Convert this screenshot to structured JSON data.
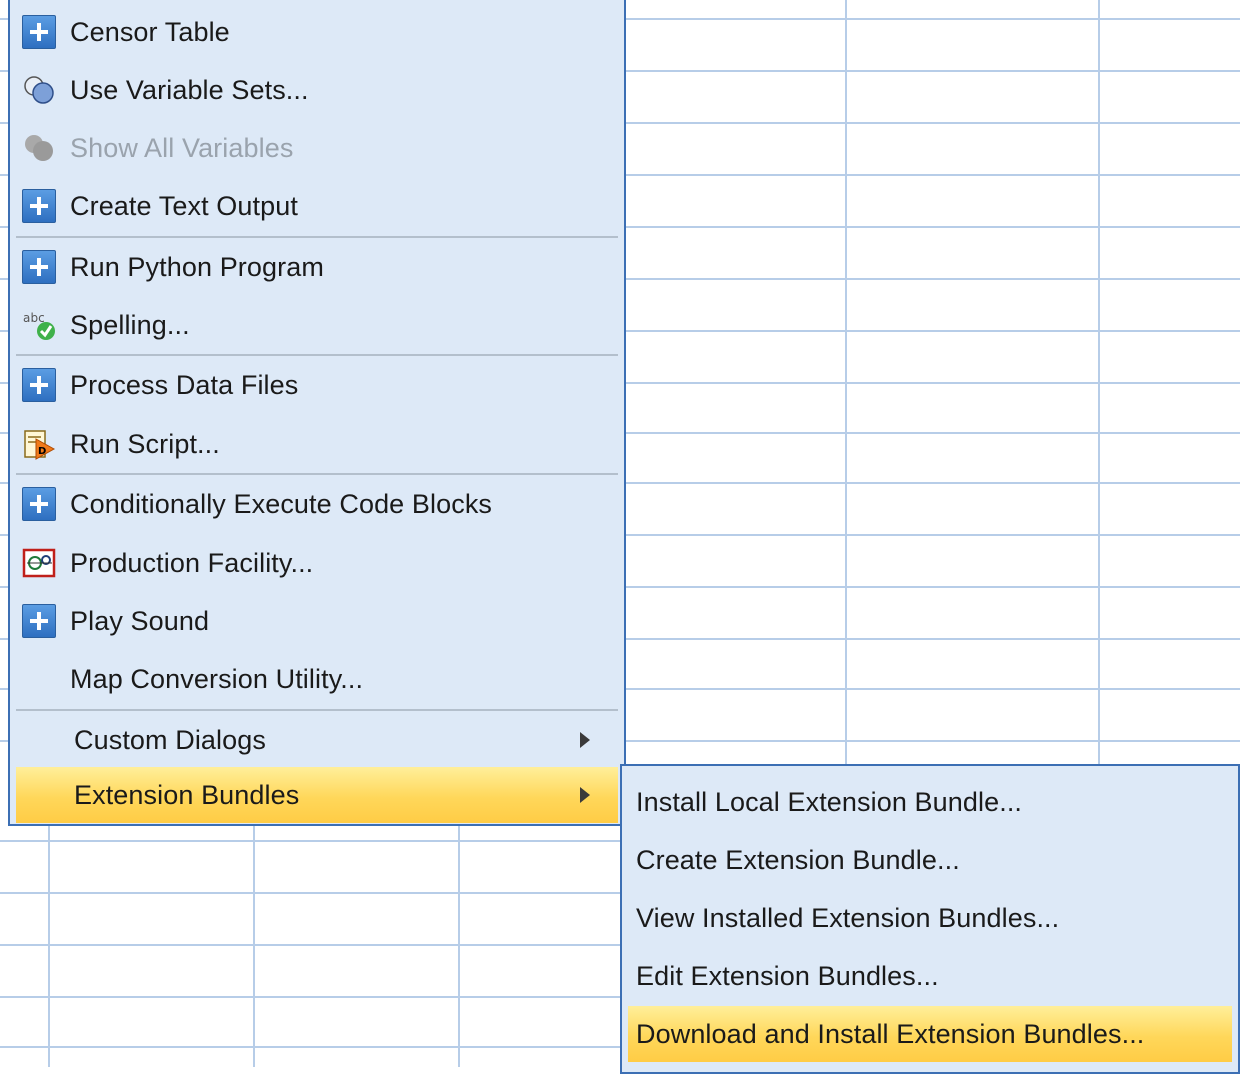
{
  "main_menu": {
    "items": [
      {
        "label": "Censor Table",
        "icon": "plus-icon",
        "enabled": true
      },
      {
        "label": "Use Variable Sets...",
        "icon": "variable-sets-icon",
        "enabled": true
      },
      {
        "label": "Show All Variables",
        "icon": "show-all-variables-icon",
        "enabled": false
      },
      {
        "label": "Create Text Output",
        "icon": "plus-icon",
        "enabled": true
      },
      {
        "label": "Run Python Program",
        "icon": "plus-icon",
        "enabled": true
      },
      {
        "label": "Spelling...",
        "icon": "spelling-icon",
        "enabled": true
      },
      {
        "label": "Process Data Files",
        "icon": "plus-icon",
        "enabled": true
      },
      {
        "label": "Run Script...",
        "icon": "run-script-icon",
        "enabled": true
      },
      {
        "label": "Conditionally Execute Code Blocks",
        "icon": "plus-icon",
        "enabled": true
      },
      {
        "label": "Production Facility...",
        "icon": "production-facility-icon",
        "enabled": true
      },
      {
        "label": "Play Sound",
        "icon": "plus-icon",
        "enabled": true
      },
      {
        "label": "Map Conversion Utility...",
        "icon": "",
        "enabled": true
      },
      {
        "label": "Custom Dialogs",
        "icon": "",
        "enabled": true,
        "submenu": true
      },
      {
        "label": "Extension Bundles",
        "icon": "",
        "enabled": true,
        "submenu": true,
        "highlighted": true
      }
    ]
  },
  "sub_menu": {
    "items": [
      {
        "label": "Install Local Extension Bundle..."
      },
      {
        "label": "Create Extension Bundle..."
      },
      {
        "label": "View Installed Extension Bundles..."
      },
      {
        "label": "Edit Extension Bundles..."
      },
      {
        "label": "Download and Install Extension Bundles...",
        "highlighted": true
      }
    ]
  },
  "colors": {
    "menu_background": "#dde9f7",
    "menu_border": "#3c6fb4",
    "highlight": "#ffd75a",
    "grid_line": "#b7cde8",
    "disabled_text": "#9aa3ad"
  }
}
